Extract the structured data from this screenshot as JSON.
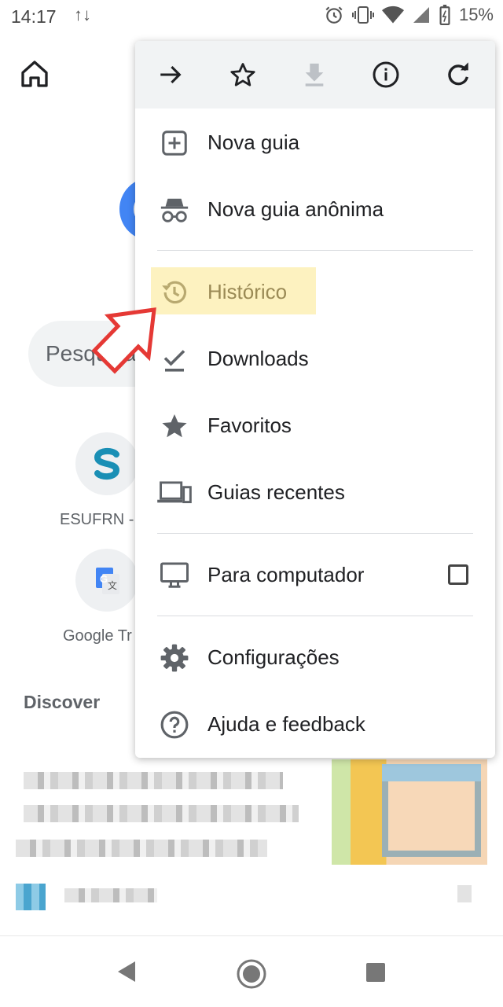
{
  "status_bar": {
    "time": "14:17",
    "data_icon": "↑↓",
    "battery": "15%"
  },
  "background": {
    "search_placeholder": "Pesquisa",
    "shortcuts": [
      {
        "label": "ESUFRN -",
        "icon": "S"
      },
      {
        "label": "Google Tr",
        "icon": "G"
      }
    ],
    "discover_label": "Discover"
  },
  "menu": {
    "toolbar": [
      "forward-icon",
      "star-icon",
      "download-icon",
      "info-icon",
      "refresh-icon"
    ],
    "items": [
      {
        "label": "Nova guia",
        "icon": "plus-box-icon"
      },
      {
        "label": "Nova guia anônima",
        "icon": "incognito-icon"
      },
      {
        "label": "Histórico",
        "icon": "history-icon",
        "highlighted": true
      },
      {
        "label": "Downloads",
        "icon": "download-check-icon"
      },
      {
        "label": "Favoritos",
        "icon": "star-filled-icon"
      },
      {
        "label": "Guias recentes",
        "icon": "devices-icon"
      },
      {
        "label": "Para computador",
        "icon": "desktop-icon",
        "checkbox_checked": false
      },
      {
        "label": "Configurações",
        "icon": "gear-icon"
      },
      {
        "label": "Ajuda e feedback",
        "icon": "help-icon"
      }
    ]
  },
  "colors": {
    "highlight": "#fdf2c0",
    "annotation_arrow": "#e53935",
    "google_blue": "#4285f4"
  }
}
